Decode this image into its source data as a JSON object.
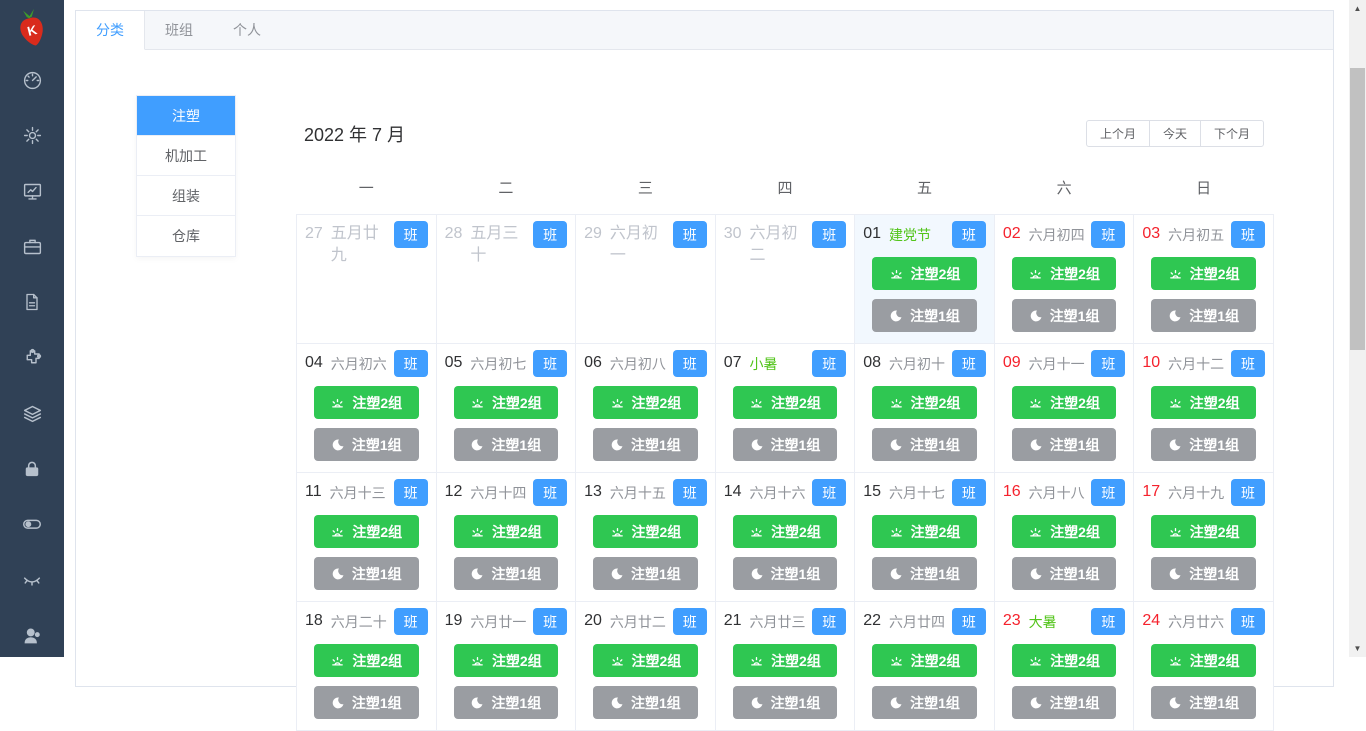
{
  "sidebar": {
    "logo_letter": "K",
    "icons": [
      "dashboard-icon",
      "settings-icon",
      "monitor-chart-icon",
      "briefcase-icon",
      "document-icon",
      "puzzle-icon",
      "layers-icon",
      "lock-icon",
      "toggle-icon",
      "eye-closed-icon",
      "user-icon"
    ]
  },
  "tabs": [
    {
      "id": "category",
      "label": "分类",
      "active": true
    },
    {
      "id": "team",
      "label": "班组",
      "active": false
    },
    {
      "id": "personal",
      "label": "个人",
      "active": false
    }
  ],
  "categories": [
    {
      "id": "injection",
      "label": "注塑",
      "active": true
    },
    {
      "id": "machining",
      "label": "机加工",
      "active": false
    },
    {
      "id": "assembly",
      "label": "组装",
      "active": false
    },
    {
      "id": "warehouse",
      "label": "仓库",
      "active": false
    }
  ],
  "calendar": {
    "title": "2022 年 7 月",
    "nav": {
      "prev": "上个月",
      "today": "今天",
      "next": "下个月"
    },
    "weekdays": [
      "一",
      "二",
      "三",
      "四",
      "五",
      "六",
      "日"
    ],
    "badge_label": "班",
    "day_shift_label": "注塑2组",
    "night_shift_label": "注塑1组",
    "weeks": [
      [
        {
          "num": "27",
          "lunar": "五月廿九",
          "muted": true
        },
        {
          "num": "28",
          "lunar": "五月三十",
          "muted": true
        },
        {
          "num": "29",
          "lunar": "六月初一",
          "muted": true
        },
        {
          "num": "30",
          "lunar": "六月初二",
          "muted": true
        },
        {
          "num": "01",
          "lunar": "建党节",
          "festival": true,
          "selected": true,
          "shifts": true
        },
        {
          "num": "02",
          "lunar": "六月初四",
          "red": true,
          "shifts": true
        },
        {
          "num": "03",
          "lunar": "六月初五",
          "red": true,
          "shifts": true
        }
      ],
      [
        {
          "num": "04",
          "lunar": "六月初六",
          "shifts": true
        },
        {
          "num": "05",
          "lunar": "六月初七",
          "shifts": true
        },
        {
          "num": "06",
          "lunar": "六月初八",
          "shifts": true
        },
        {
          "num": "07",
          "lunar": "小暑",
          "festival": true,
          "shifts": true
        },
        {
          "num": "08",
          "lunar": "六月初十",
          "shifts": true
        },
        {
          "num": "09",
          "lunar": "六月十一",
          "red": true,
          "shifts": true
        },
        {
          "num": "10",
          "lunar": "六月十二",
          "red": true,
          "shifts": true
        }
      ],
      [
        {
          "num": "11",
          "lunar": "六月十三",
          "shifts": true
        },
        {
          "num": "12",
          "lunar": "六月十四",
          "shifts": true
        },
        {
          "num": "13",
          "lunar": "六月十五",
          "shifts": true
        },
        {
          "num": "14",
          "lunar": "六月十六",
          "shifts": true
        },
        {
          "num": "15",
          "lunar": "六月十七",
          "shifts": true
        },
        {
          "num": "16",
          "lunar": "六月十八",
          "red": true,
          "shifts": true
        },
        {
          "num": "17",
          "lunar": "六月十九",
          "red": true,
          "shifts": true
        }
      ],
      [
        {
          "num": "18",
          "lunar": "六月二十",
          "shifts": true
        },
        {
          "num": "19",
          "lunar": "六月廿一",
          "shifts": true
        },
        {
          "num": "20",
          "lunar": "六月廿二",
          "shifts": true
        },
        {
          "num": "21",
          "lunar": "六月廿三",
          "shifts": true
        },
        {
          "num": "22",
          "lunar": "六月廿四",
          "shifts": true
        },
        {
          "num": "23",
          "lunar": "大暑",
          "red": true,
          "festival": true,
          "shifts": true
        },
        {
          "num": "24",
          "lunar": "六月廿六",
          "red": true,
          "shifts": true
        }
      ]
    ]
  },
  "colors": {
    "accent": "#409eff",
    "day_shift_green": "#2fc752",
    "night_shift_gray": "#9a9da2",
    "weekend_red": "#f5222d",
    "festival_green": "#52c41a",
    "sidebar_bg": "#304156",
    "selected_day_bg": "#f2f8fe"
  }
}
